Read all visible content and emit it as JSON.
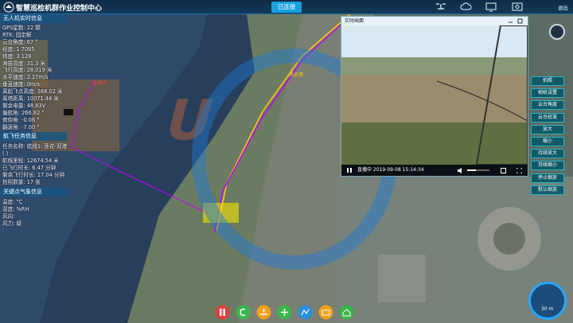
{
  "app": {
    "title": "智慧巡检机群作业控制中心",
    "connection_status": "已连接",
    "exit_label": "退出"
  },
  "status_panel": {
    "title": "无人机实时信息",
    "rows": [
      "GPS星数: 22 颗",
      "RTK: 固定解",
      "云台角度: 67 °",
      "经度: 1       7085",
      "纬度: 3         128",
      "海拔高度: 31.3 米",
      "飞行高度: 28.019 米",
      "水平速度: 2.27m/s",
      "垂直速度:       0m/s",
      "离起飞点高度: 368.02 米",
      "离塔距离: 10071.44 米",
      "剩余电量: 48.83V",
      "偏航角: 266.82 °",
      "俯仰角: -0.06 °",
      "翻滚角: -7.00 °"
    ]
  },
  "mission_panel": {
    "title": "航飞任务信息",
    "rows": [
      "任务名称: 航线1: 莲花-双港",
      "(     )",
      "航线里程: 12674.54 米",
      "已飞行时长: 6.47 分钟",
      "剩余飞行时长: 17.04 分钟",
      "拍照数量: 17 张"
    ]
  },
  "weather_panel": {
    "title": "关键点气象信息",
    "rows": [
      "温度:   °C",
      "湿度:   %RH",
      "风向:",
      "风力:  级"
    ]
  },
  "video": {
    "title": "实时画面",
    "timestamp": "直播中 2019-09-08 15:14:34",
    "volume": 0.4
  },
  "controls": [
    "拍照",
    "相机设置",
    "云台角度",
    "云台校准",
    "放大",
    "缩小",
    "持续放大",
    "持续缩小",
    "停止缩放",
    "默认缩放"
  ],
  "map": {
    "markers": [
      "终点塔",
      "出发点"
    ],
    "scale_label": "30 m"
  },
  "toolbar_icons": [
    "pause-icon",
    "return-icon",
    "land-icon",
    "takeoff-icon",
    "waypoint-icon",
    "photo-icon",
    "home-icon"
  ],
  "colors": {
    "accent": "#1aa0e0",
    "route": "#c000ff",
    "mission_line": "#ffd000",
    "button": "#0f5a66"
  }
}
